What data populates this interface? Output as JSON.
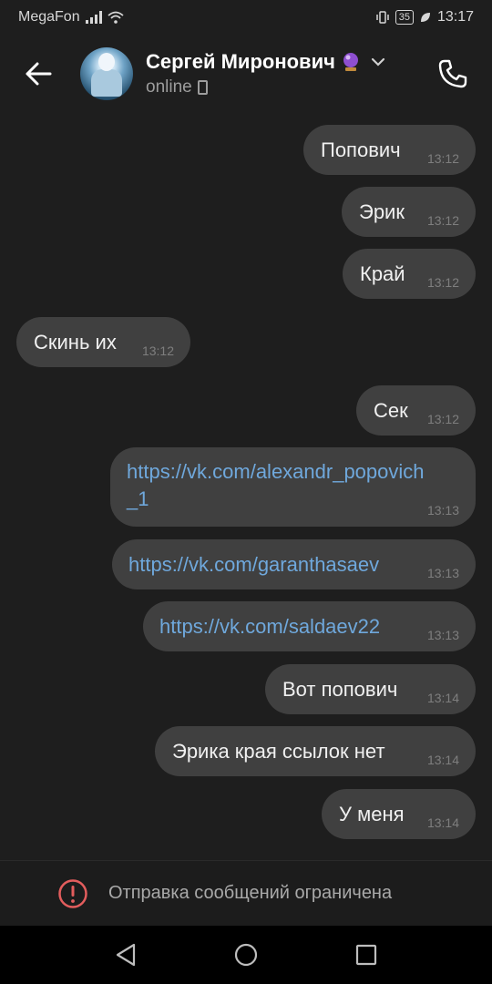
{
  "status_bar": {
    "carrier": "MegaFon",
    "battery": "35",
    "time": "13:17"
  },
  "header": {
    "contact_name": "Сергей Миронович",
    "status": "online"
  },
  "messages": [
    {
      "text": "Попович",
      "time": "13:12",
      "side": "out"
    },
    {
      "text": "Эрик",
      "time": "13:12",
      "side": "out"
    },
    {
      "text": "Край",
      "time": "13:12",
      "side": "out"
    },
    {
      "text": "Скинь их",
      "time": "13:12",
      "side": "in"
    },
    {
      "text": "Сек",
      "time": "13:12",
      "side": "out"
    },
    {
      "text_line1": "https://vk.com/alexandr_popovich",
      "text_line2": "_1",
      "time": "13:13",
      "side": "out",
      "link": true
    },
    {
      "text": "https://vk.com/garanthasaev",
      "time": "13:13",
      "side": "out",
      "link": true
    },
    {
      "text": "https://vk.com/saldaev22",
      "time": "13:13",
      "side": "out",
      "link": true
    },
    {
      "text": "Вот попович",
      "time": "13:14",
      "side": "out"
    },
    {
      "text": "Эрика края ссылок нет",
      "time": "13:14",
      "side": "out"
    },
    {
      "text": "У меня",
      "time": "13:14",
      "side": "out"
    }
  ],
  "bottom_bar": {
    "restricted_text": "Отправка сообщений ограничена"
  },
  "colors": {
    "background": "#1e1e1e",
    "bubble": "#404040",
    "link": "#6fa8dc",
    "warning": "#e35d5d"
  }
}
